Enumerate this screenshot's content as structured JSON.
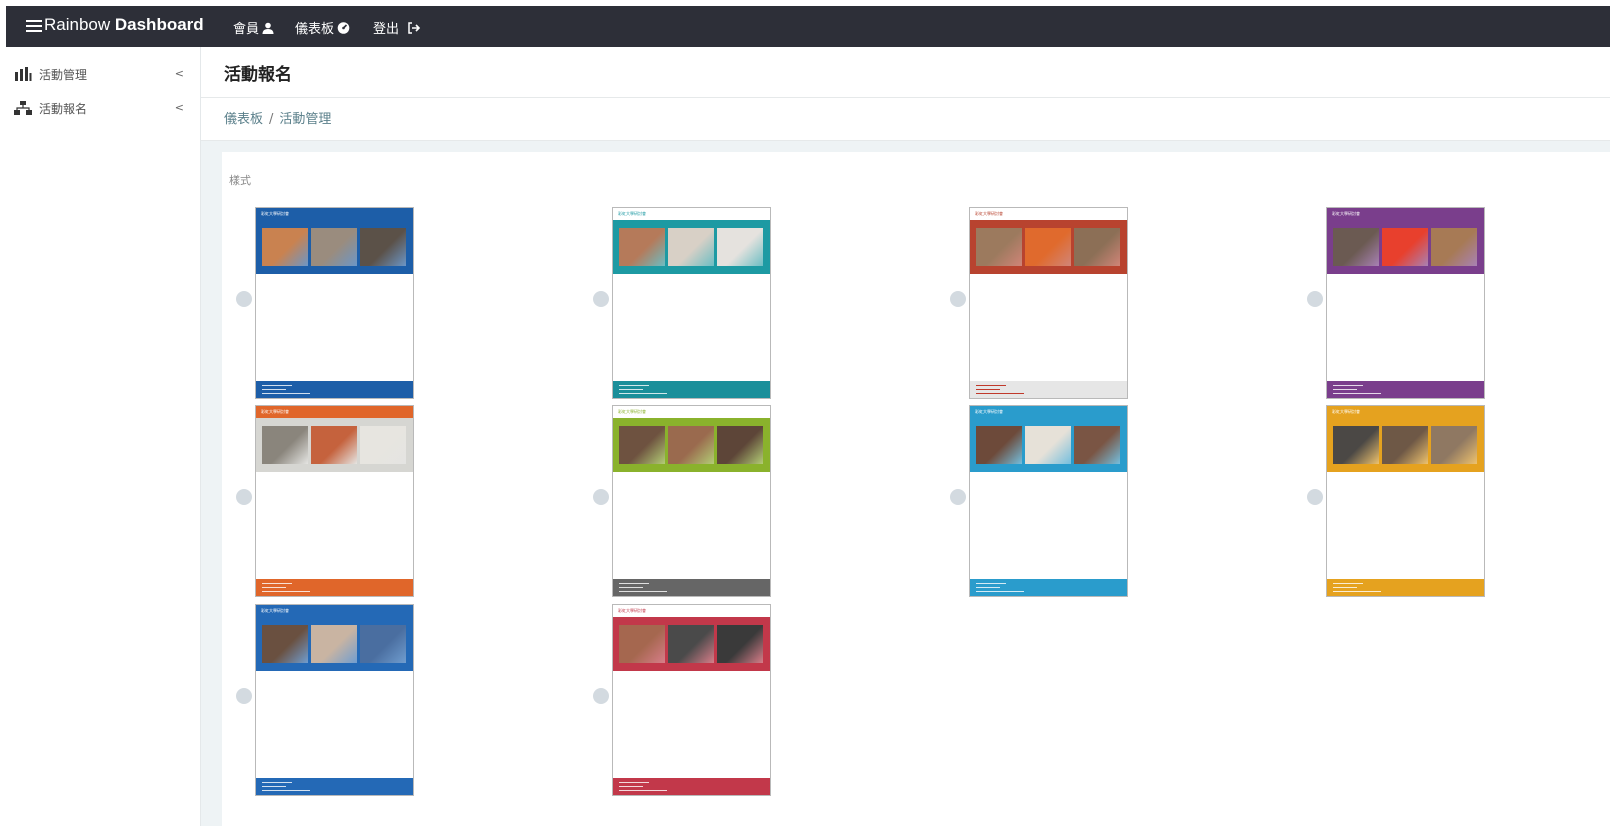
{
  "navbar": {
    "brand_light": "Rainbow ",
    "brand_bold": "Dashboard",
    "items": [
      {
        "label": "會員",
        "icon": "user-icon"
      },
      {
        "label": "儀表板",
        "icon": "dashboard-icon"
      },
      {
        "label": "登出",
        "icon": "sign-out-icon"
      }
    ]
  },
  "sidebar": {
    "items": [
      {
        "label": "活動管理",
        "icon": "bar-chart-icon"
      },
      {
        "label": "活動報名",
        "icon": "sitemap-icon"
      }
    ]
  },
  "page": {
    "title": "活動報名",
    "breadcrumb": [
      "儀表板",
      "活動管理"
    ],
    "section_label": "樣式"
  },
  "templates": [
    {
      "heading": "彩虹大學研討會",
      "top": "#1d5ea8",
      "banner": "#1d5ea8",
      "photo": [
        "#c98250",
        "#9a8c7e",
        "#5b5148"
      ],
      "foot": "#1d5ea8"
    },
    {
      "heading": "彩虹大學研討會",
      "top": "#ffffff",
      "banner": "#1d9aa3",
      "photo": [
        "#b57a5a",
        "#d8d0c6",
        "#e5e2de"
      ],
      "foot": "#1b8f9a"
    },
    {
      "heading": "彩虹大學研討會",
      "top": "#ffffff",
      "banner": "#b8432f",
      "photo": [
        "#9c7a5e",
        "#e06a2d",
        "#8c6f56"
      ],
      "foot": "#e6e6e6"
    },
    {
      "heading": "彩虹大學研討會",
      "top": "#7a3e8c",
      "banner": "#7a3e8c",
      "photo": [
        "#6b5a52",
        "#e8402d",
        "#a77a55"
      ],
      "foot": "#7a3e8c"
    },
    {
      "heading": "彩虹大學研討會",
      "top": "#e0662a",
      "banner": "#d6d6d2",
      "photo": [
        "#8a857c",
        "#c5623d",
        "#e7e5e0"
      ],
      "foot": "#e0662a"
    },
    {
      "heading": "彩虹大學研討會",
      "top": "#ffffff",
      "banner": "#8ab22c",
      "photo": [
        "#6e5240",
        "#9a6a4e",
        "#5d4538"
      ],
      "foot": "#666666"
    },
    {
      "heading": "彩虹大學研討會",
      "top": "#2a9ccc",
      "banner": "#2a9ccc",
      "photo": [
        "#6d4a3a",
        "#e6e1d8",
        "#7a5544"
      ],
      "foot": "#2a9ccc"
    },
    {
      "heading": "彩虹大學研討會",
      "top": "#e5a21f",
      "banner": "#e5a21f",
      "photo": [
        "#4b4845",
        "#6e5846",
        "#8f7862"
      ],
      "foot": "#e5a21f"
    },
    {
      "heading": "彩虹大學研討會",
      "top": "#2469b6",
      "banner": "#2469b6",
      "photo": [
        "#6a5040",
        "#c9b4a2",
        "#4a6ea0"
      ],
      "foot": "#2469b6"
    },
    {
      "heading": "彩虹大學研討會",
      "top": "#ffffff",
      "banner": "#c2384a",
      "photo": [
        "#a5674f",
        "#4a4a4a",
        "#3a3a3a"
      ],
      "foot": "#c2384a"
    }
  ],
  "colors": {
    "navbar_bg": "#2d2f38",
    "breadcrumb": "#5a7f8a",
    "content_bg": "#eef3f5"
  }
}
